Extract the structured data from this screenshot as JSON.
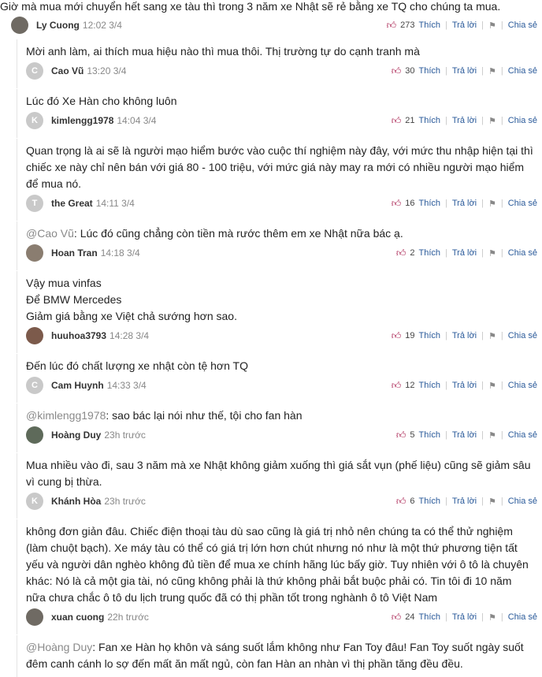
{
  "ui": {
    "like_label": "Thích",
    "reply_label": "Trả lời",
    "share_label": "Chia sẻ"
  },
  "comments": [
    {
      "text": "Giờ mà mua mới chuyển hết sang xe tàu thì trong 3 năm xe Nhật sẽ rẻ bằng xe TQ cho chúng ta mua.",
      "author": "Ly Cuong",
      "time": "12:02 3/4",
      "likes": "273"
    },
    {
      "text": "Mời anh làm, ai thích mua hiệu nào thì mua thôi. Thị trường tự do cạnh tranh mà",
      "author": "Cao Vũ",
      "time": "13:20 3/4",
      "likes": "30",
      "avatar_letter": "C"
    },
    {
      "text": "Lúc đó Xe Hàn cho không luôn",
      "author": "kimlengg1978",
      "time": "14:04 3/4",
      "likes": "21",
      "avatar_letter": "K"
    },
    {
      "text": "Quan trọng là ai sẽ là người mạo hiểm bước vào cuộc thí nghiệm này đây, với mức thu nhập hiện tại thì chiếc xe này chỉ nên bán với giá 80 - 100 triệu, với mức giá này may ra mới có nhiều người mạo hiểm để mua nó.",
      "author": "the Great",
      "time": "14:11 3/4",
      "likes": "16",
      "avatar_letter": "T"
    },
    {
      "mention": "@Cao Vũ",
      "text": ": Lúc đó cũng chẳng còn tiền mà rước thêm em xe Nhật nữa bác ạ.",
      "author": "Hoan Tran",
      "time": "14:18 3/4",
      "likes": "2"
    },
    {
      "lines": [
        "Vậy mua vinfas",
        "Để BMW Mercedes",
        "Giảm giá bằng xe Việt chả sướng hơn sao."
      ],
      "author": "huuhoa3793",
      "time": "14:28 3/4",
      "likes": "19"
    },
    {
      "text": "Đến lúc đó chất lượng xe nhật còn tệ hơn TQ",
      "author": "Cam Huynh",
      "time": "14:33 3/4",
      "likes": "12",
      "avatar_letter": "C"
    },
    {
      "mention": "@kimlengg1978",
      "text": ": sao bác lại nói như thế, tội cho fan hàn",
      "author": "Hoàng Duy",
      "time": "23h trước",
      "likes": "5"
    },
    {
      "text": "Mua nhiều vào đi, sau 3 năm mà xe Nhật không giảm xuống thì giá sắt vụn (phế liệu) cũng sẽ giảm sâu vì cung bị thừa.",
      "author": "Khánh Hòa",
      "time": "23h trước",
      "likes": "6",
      "avatar_letter": "K"
    },
    {
      "text": "không đơn giản đâu. Chiếc điện thoại tàu dù sao cũng là giá trị nhỏ nên chúng ta có thể thử nghiệm (làm chuột bạch). Xe máy tàu có thể có giá trị lớn hơn chút nhưng nó như là một thứ phương tiện tất yếu và người dân nghèo không đủ tiền để mua xe chính hãng lúc bấy giờ. Tuy nhiên với ô tô là chuyên khác: Nó là cả một gia tài, nó cũng không phải là thứ không phải bắt buộc phải có. Tin tôi đi 10 năm nữa chưa chắc ô tô du lịch trung quốc đã có thị phần tốt trong nghành ô tô Việt Nam",
      "author": "xuan cuong",
      "time": "22h trước",
      "likes": "24"
    },
    {
      "mention": "@Hoàng Duy",
      "text": ": Fan xe Hàn họ khôn và sáng suốt lắm không như Fan Toy đâu! Fan Toy suốt ngày suốt đêm canh cánh lo sợ đến mất ăn mất ngủ, còn fan Hàn an nhàn vì thị phần tăng đều đều."
    }
  ]
}
